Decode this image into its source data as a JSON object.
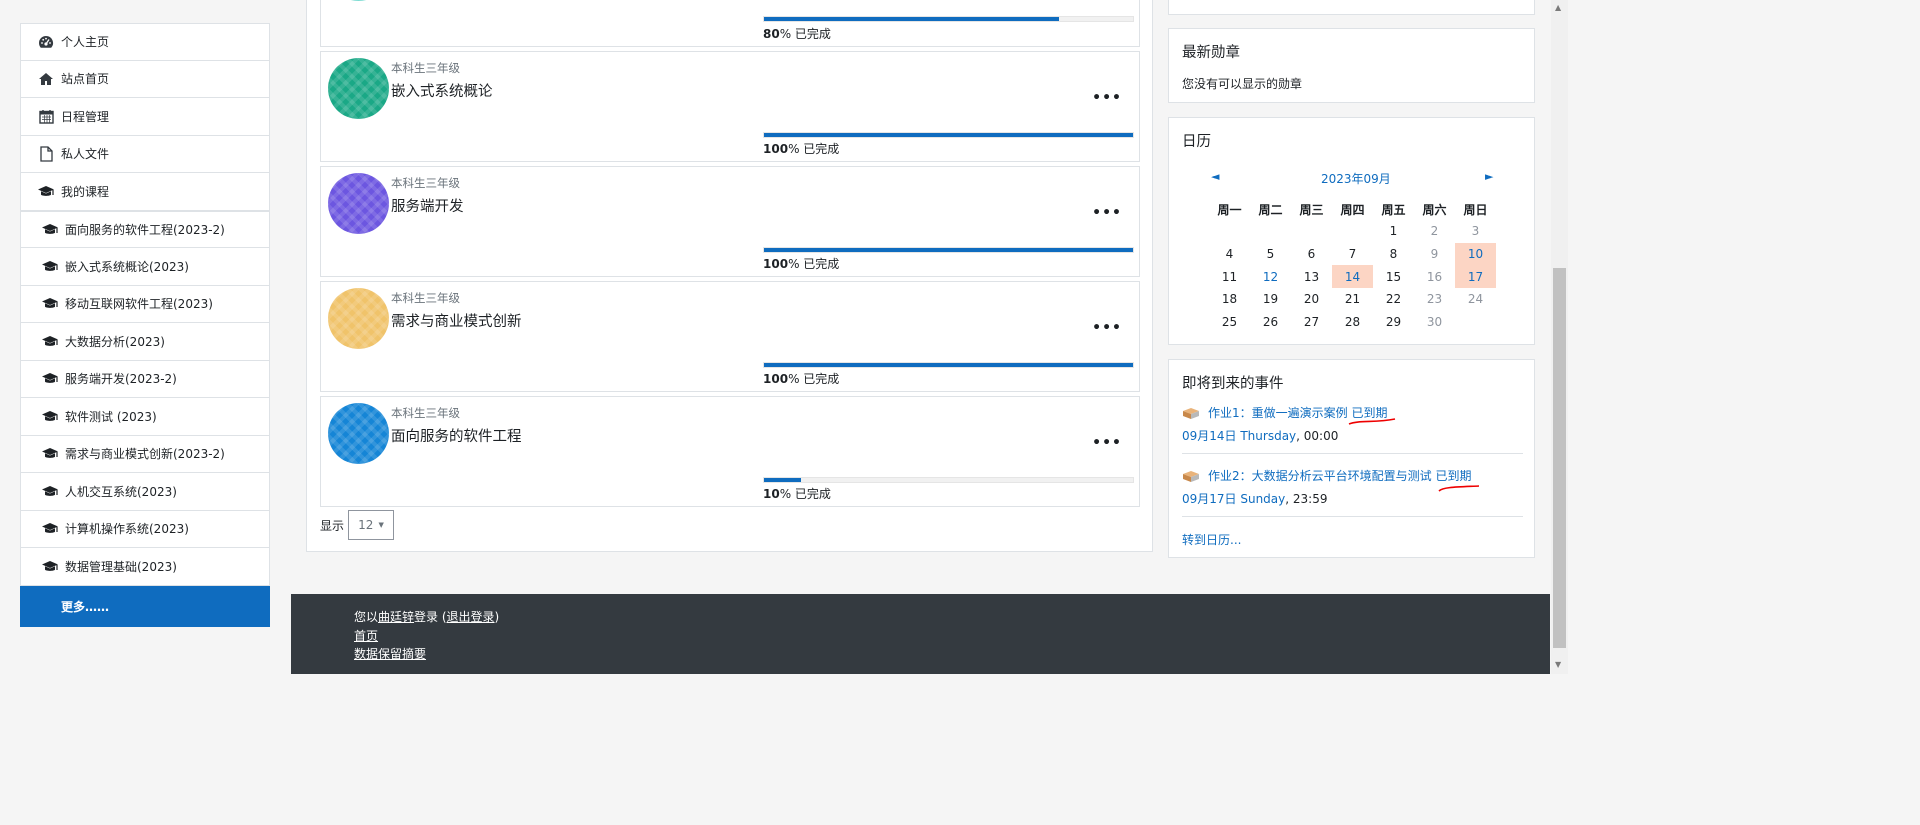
{
  "sidebar": {
    "items": [
      {
        "label": "个人主页",
        "icon": "dashboard-icon"
      },
      {
        "label": "站点首页",
        "icon": "home-icon"
      },
      {
        "label": "日程管理",
        "icon": "calendar-icon"
      },
      {
        "label": "私人文件",
        "icon": "file-icon"
      },
      {
        "label": "我的课程",
        "icon": "graduation-cap-icon"
      }
    ],
    "courses": [
      "面向服务的软件工程(2023-2)",
      "嵌入式系统概论(2023)",
      "移动互联网软件工程(2023)",
      "大数据分析(2023)",
      "服务端开发(2023-2)",
      "软件测试 (2023)",
      "需求与商业模式创新(2023-2)",
      "人机交互系统(2023)",
      "计算机操作系统(2023)",
      "数据管理基础(2023)"
    ],
    "more_label": "更多……"
  },
  "main": {
    "first_progress": {
      "percent": "80",
      "suffix": "% 已完成",
      "value": 0.8
    },
    "courses": [
      {
        "category": "本科生三年级",
        "name": "嵌入式系统概论",
        "percent": "100",
        "suffix": "% 已完成",
        "value": 1.0,
        "color": "#1aa886"
      },
      {
        "category": "本科生三年级",
        "name": "服务端开发",
        "percent": "100",
        "suffix": "% 已完成",
        "value": 1.0,
        "color": "#6c56e0"
      },
      {
        "category": "本科生三年级",
        "name": "需求与商业模式创新",
        "percent": "100",
        "suffix": "% 已完成",
        "value": 1.0,
        "color": "#f0c36a"
      },
      {
        "category": "本科生三年级",
        "name": "面向服务的软件工程",
        "percent": "10",
        "suffix": "% 已完成",
        "value": 0.1,
        "color": "#1585d6"
      }
    ],
    "menu_glyph": "•••",
    "show_label": "显示",
    "show_value": "12"
  },
  "badges": {
    "title": "最新勋章",
    "empty_text": "您没有可以显示的勋章"
  },
  "calendar": {
    "title": "日历",
    "month": "2023年09月",
    "prev": "◄",
    "next": "►",
    "weekdays": [
      "周一",
      "周二",
      "周三",
      "周四",
      "周五",
      "周六",
      "周日"
    ],
    "weeks": [
      [
        "",
        "",
        "",
        "",
        "1",
        "2",
        "3"
      ],
      [
        "4",
        "5",
        "6",
        "7",
        "8",
        "9",
        "10"
      ],
      [
        "11",
        "12",
        "13",
        "14",
        "15",
        "16",
        "17"
      ],
      [
        "18",
        "19",
        "20",
        "21",
        "22",
        "23",
        "24"
      ],
      [
        "25",
        "26",
        "27",
        "28",
        "29",
        "30",
        ""
      ]
    ],
    "event_days": [
      "10",
      "14",
      "17"
    ],
    "link_days": [
      "12"
    ],
    "highlight_color": "#fcd5c4"
  },
  "upcoming": {
    "title": "即将到来的事件",
    "events": [
      {
        "title": "作业1：重做一遍演示案例",
        "status": "已到期",
        "date": "09月14日 Thursday",
        "time": ", 00:00"
      },
      {
        "title": "作业2：大数据分析云平台环境配置与测试",
        "status": "已到期",
        "date": "09月17日 Sunday",
        "time": ", 23:59"
      }
    ],
    "goto_label": "转到日历..."
  },
  "footer": {
    "login_prefix": "您以",
    "user": "曲廷锌",
    "login_mid": "登录 (",
    "logout": "退出登录",
    "login_suffix": ")",
    "home": "首页",
    "data_retention": "数据保留摘要"
  }
}
